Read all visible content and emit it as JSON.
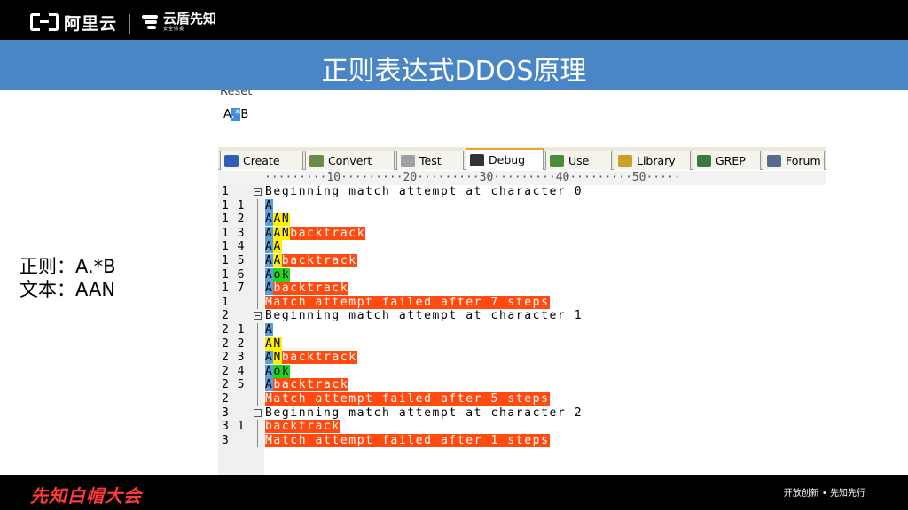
{
  "header": {
    "brand_aliyun": "阿里云",
    "brand_yundun": "云盾先知",
    "brand_yundun_sub": "安全情报"
  },
  "title": "正则表达式DDOS原理",
  "caption": {
    "line1": "正则：A.*B",
    "line2": "文本：AAN"
  },
  "tool": {
    "reset_label": "Reset",
    "regex": {
      "before": "A",
      "selected": ".*",
      "after": "B"
    },
    "tabs": [
      {
        "label": "Create",
        "icon": "create-icon",
        "color": "#2f5fb3"
      },
      {
        "label": "Convert",
        "icon": "convert-icon",
        "color": "#6a8a4a"
      },
      {
        "label": "Test",
        "icon": "test-icon",
        "color": "#a0a0a0"
      },
      {
        "label": "Debug",
        "icon": "debug-icon",
        "color": "#333333"
      },
      {
        "label": "Use",
        "icon": "use-icon",
        "color": "#4d8a3a"
      },
      {
        "label": "Library",
        "icon": "library-icon",
        "color": "#c9a227"
      },
      {
        "label": "GREP",
        "icon": "grep-icon",
        "color": "#3a7a3a"
      },
      {
        "label": "Forum",
        "icon": "forum-icon",
        "color": "#5a6a8a"
      }
    ],
    "active_tab": "Debug",
    "ruler": "·········10·········20·········30·········40·········50·····",
    "debug_lines": [
      {
        "num": "1",
        "segs": [
          {
            "t": "Beginning match attempt at character 0",
            "c": ""
          }
        ],
        "header": true
      },
      {
        "num": "1 1",
        "segs": [
          {
            "t": "A",
            "c": "hl-blue"
          }
        ]
      },
      {
        "num": "1 2",
        "segs": [
          {
            "t": "A",
            "c": "hl-blue"
          },
          {
            "t": "AN",
            "c": "hl-yellow"
          }
        ]
      },
      {
        "num": "1 3",
        "segs": [
          {
            "t": "A",
            "c": "hl-blue"
          },
          {
            "t": "AN",
            "c": "hl-yellow"
          },
          {
            "t": "backtrack",
            "c": "hl-red"
          }
        ]
      },
      {
        "num": "1 4",
        "segs": [
          {
            "t": "A",
            "c": "hl-blue"
          },
          {
            "t": "A",
            "c": "hl-yellow"
          }
        ]
      },
      {
        "num": "1 5",
        "segs": [
          {
            "t": "A",
            "c": "hl-blue"
          },
          {
            "t": "A",
            "c": "hl-yellow"
          },
          {
            "t": "backtrack",
            "c": "hl-red"
          }
        ]
      },
      {
        "num": "1 6",
        "segs": [
          {
            "t": "A",
            "c": "hl-blue"
          },
          {
            "t": "ok",
            "c": "hl-green"
          }
        ]
      },
      {
        "num": "1 7",
        "segs": [
          {
            "t": "A",
            "c": "hl-blue"
          },
          {
            "t": "backtrack",
            "c": "hl-red"
          }
        ]
      },
      {
        "num": "1",
        "segs": [
          {
            "t": "Match attempt failed after 7 steps",
            "c": "hl-red"
          }
        ]
      },
      {
        "num": "2",
        "segs": [
          {
            "t": "Beginning match attempt at character 1",
            "c": ""
          }
        ],
        "header": true
      },
      {
        "num": "2 1",
        "segs": [
          {
            "t": "A",
            "c": "hl-blue"
          }
        ]
      },
      {
        "num": "2 2",
        "segs": [
          {
            "t": "AN",
            "c": "hl-yellow"
          }
        ]
      },
      {
        "num": "2 3",
        "segs": [
          {
            "t": "A",
            "c": "hl-blue"
          },
          {
            "t": "N",
            "c": "hl-yellow"
          },
          {
            "t": "backtrack",
            "c": "hl-red"
          }
        ]
      },
      {
        "num": "2 4",
        "segs": [
          {
            "t": "A",
            "c": "hl-blue"
          },
          {
            "t": "ok",
            "c": "hl-green"
          }
        ]
      },
      {
        "num": "2 5",
        "segs": [
          {
            "t": "A",
            "c": "hl-blue"
          },
          {
            "t": "backtrack",
            "c": "hl-red"
          }
        ]
      },
      {
        "num": "2",
        "segs": [
          {
            "t": "Match attempt failed after 5 steps",
            "c": "hl-red"
          }
        ]
      },
      {
        "num": "3",
        "segs": [
          {
            "t": "Beginning match attempt at character 2",
            "c": ""
          }
        ],
        "header": true
      },
      {
        "num": "3 1",
        "segs": [
          {
            "t": "backtrack",
            "c": "hl-red"
          }
        ]
      },
      {
        "num": "3",
        "segs": [
          {
            "t": "Match attempt failed after 1 steps",
            "c": "hl-red"
          }
        ]
      }
    ]
  },
  "footer": {
    "brand": "先知白帽大会",
    "slogan": "开放创新 • 先知先行"
  },
  "colors": {
    "title_band": "#4a86c5",
    "backtrack": "#ff4a10",
    "ok": "#1fd51f",
    "advance": "#ffef00",
    "match": "#5b9ee0",
    "footer_brand": "#ff3a3a"
  }
}
